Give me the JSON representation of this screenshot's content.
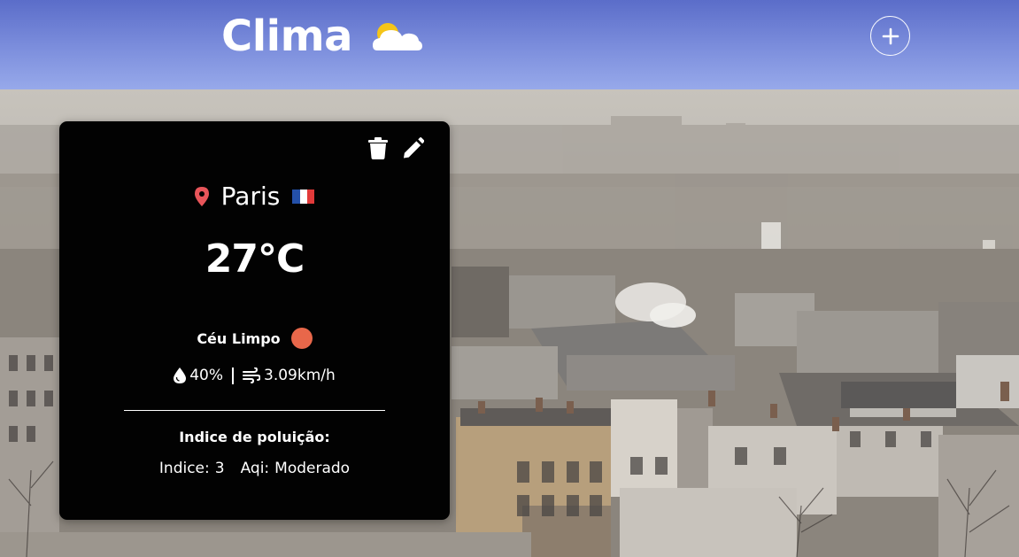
{
  "header": {
    "title": "Clima",
    "logo_icon": "sun-cloud-icon",
    "add_icon": "plus-icon"
  },
  "background": {
    "description_icon": "city-rooftops-photo"
  },
  "card": {
    "actions": {
      "delete_icon": "trash-icon",
      "edit_icon": "pencil-icon"
    },
    "location": {
      "icon": "map-pin-icon",
      "city": "Paris",
      "flag_icon": "france-flag-icon"
    },
    "temperature": "27°C",
    "condition": {
      "label": "Céu Limpo",
      "indicator_color": "#e8674a"
    },
    "humidity": {
      "icon": "water-drop-icon",
      "value": "40%"
    },
    "wind": {
      "icon": "wind-icon",
      "value": "3.09km/h"
    },
    "pollution": {
      "title": "Indice de poluição:",
      "index_label": "Indice:",
      "index_value": "3",
      "aqi_label": "Aqi:",
      "aqi_value": "Moderado"
    }
  },
  "colors": {
    "header_top": "#5b6dc9",
    "header_bottom": "#97a9ea",
    "card_bg": "#020202",
    "pin": "#e8555a",
    "sun": "#f5c518"
  }
}
